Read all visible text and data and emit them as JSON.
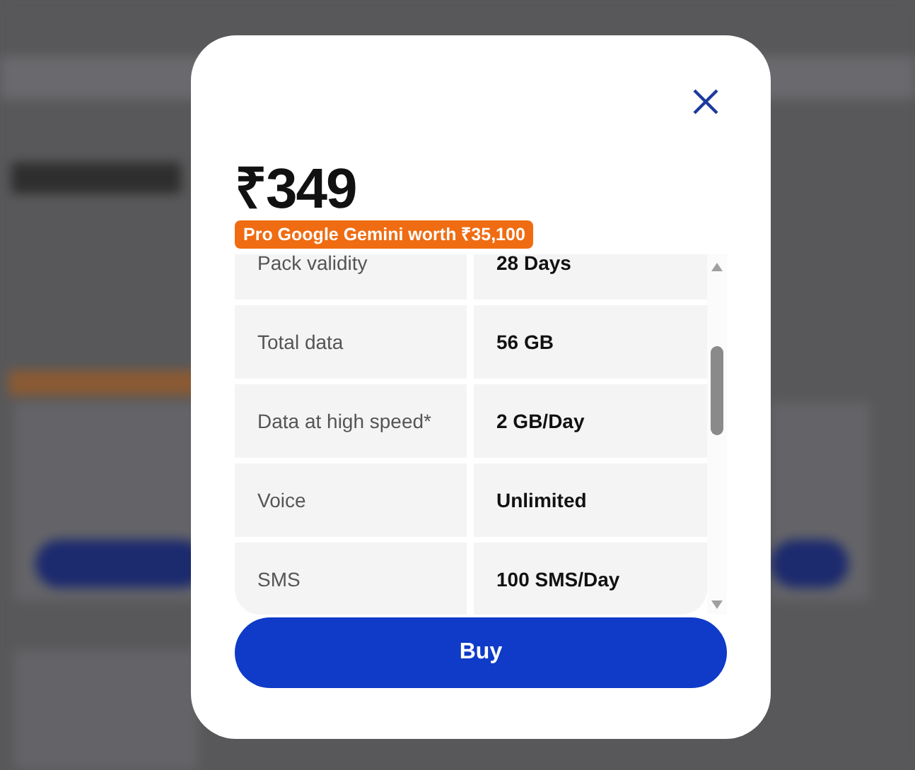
{
  "dialog": {
    "price": "₹349",
    "offer_badge": "Pro Google Gemini worth ₹35,100",
    "benefits": [
      {
        "label": "Pack validity",
        "value": "28 Days"
      },
      {
        "label": "Total data",
        "value": "56 GB"
      },
      {
        "label": "Data at high speed*",
        "value": "2 GB/Day"
      },
      {
        "label": "Voice",
        "value": "Unlimited"
      },
      {
        "label": "SMS",
        "value": "100 SMS/Day"
      }
    ],
    "primary_button": "Buy"
  }
}
